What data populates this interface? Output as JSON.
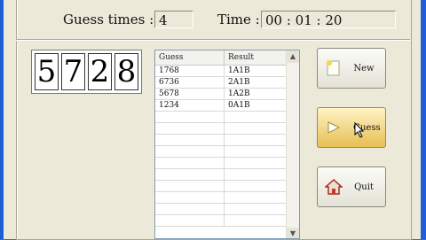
{
  "header": {
    "guess_times_label": "Guess times :",
    "guess_times_value": "4",
    "time_label": "Time :",
    "time_value": "00 : 01 : 20"
  },
  "digits": [
    "5",
    "7",
    "2",
    "8"
  ],
  "table": {
    "columns": [
      "Guess",
      "Result"
    ],
    "rows": [
      [
        "1768",
        "1A1B"
      ],
      [
        "6736",
        "2A1B"
      ],
      [
        "5678",
        "1A2B"
      ],
      [
        "1234",
        "0A1B"
      ],
      [
        "",
        ""
      ],
      [
        "",
        ""
      ],
      [
        "",
        ""
      ],
      [
        "",
        ""
      ],
      [
        "",
        ""
      ],
      [
        "",
        ""
      ],
      [
        "",
        ""
      ],
      [
        "",
        ""
      ],
      [
        "",
        ""
      ],
      [
        "",
        ""
      ]
    ]
  },
  "buttons": {
    "new_label": "New",
    "guess_label": "Guess",
    "quit_label": "Quit"
  }
}
